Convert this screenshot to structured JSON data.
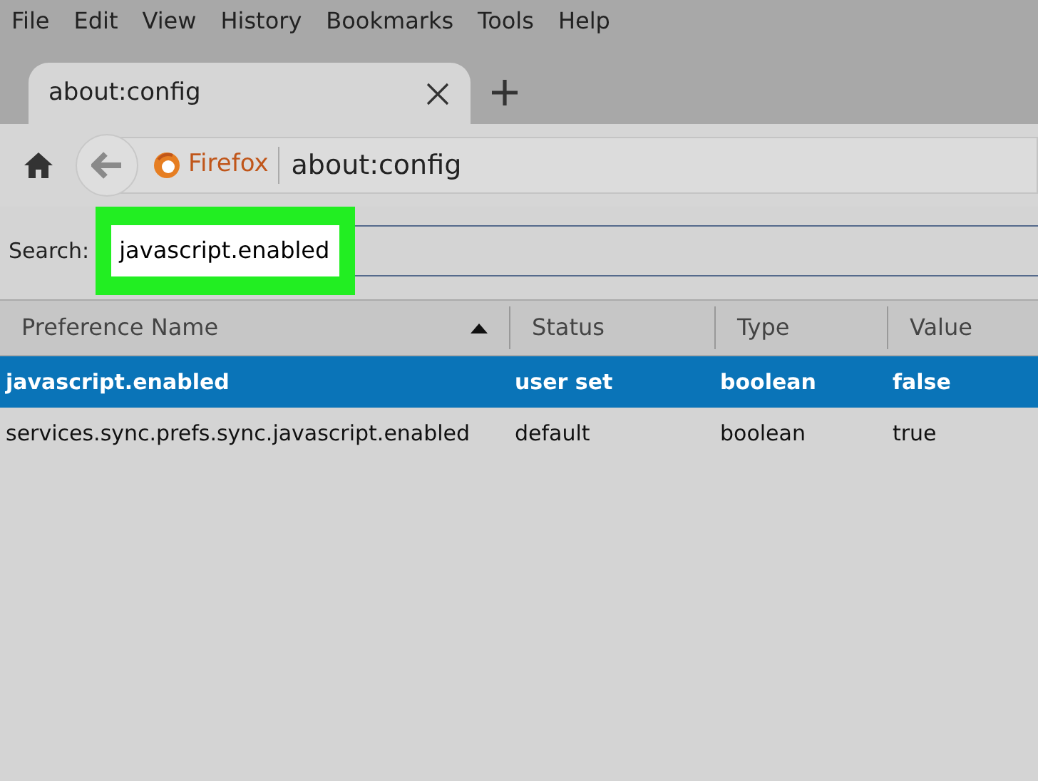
{
  "menu_bar": [
    {
      "label": "File"
    },
    {
      "label": "Edit"
    },
    {
      "label": "View"
    },
    {
      "label": "History"
    },
    {
      "label": "Bookmarks"
    },
    {
      "label": "Tools"
    },
    {
      "label": "Help"
    }
  ],
  "tabs": [
    {
      "label": "about:config",
      "selected": true
    }
  ],
  "address_bar": {
    "identity": "Firefox",
    "url": "about:config"
  },
  "search": {
    "label": "Search:",
    "value": "javascript.enabled",
    "highlighted": true
  },
  "table": {
    "columns": [
      {
        "label": "Preference Name",
        "sorted": true
      },
      {
        "label": "Status",
        "sorted": false
      },
      {
        "label": "Type",
        "sorted": false
      },
      {
        "label": "Value",
        "sorted": false
      }
    ],
    "rows": [
      {
        "cells": [
          "javascript.enabled",
          "user set",
          "boolean",
          "false"
        ],
        "selected": true
      },
      {
        "cells": [
          "services.sync.prefs.sync.javascript.enabled",
          "default",
          "boolean",
          "true"
        ],
        "selected": false
      }
    ]
  }
}
